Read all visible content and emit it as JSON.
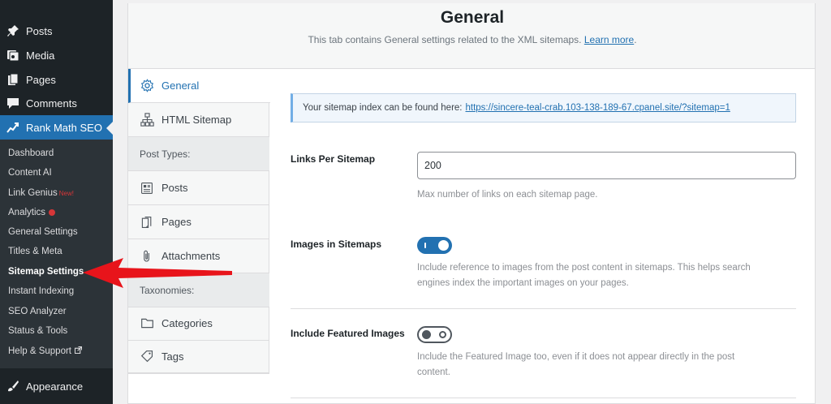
{
  "sidebar": {
    "menu": [
      {
        "label": "Posts",
        "icon": "pushpin-icon"
      },
      {
        "label": "Media",
        "icon": "media-icon"
      },
      {
        "label": "Pages",
        "icon": "pages-icon"
      },
      {
        "label": "Comments",
        "icon": "comment-icon"
      },
      {
        "label": "Rank Math SEO",
        "icon": "rank-math-icon"
      }
    ],
    "submenu": [
      {
        "label": "Dashboard"
      },
      {
        "label": "Content AI"
      },
      {
        "label": "Link Genius",
        "badge": "New!"
      },
      {
        "label": "Analytics"
      },
      {
        "label": "General Settings"
      },
      {
        "label": "Titles & Meta"
      },
      {
        "label": "Sitemap Settings"
      },
      {
        "label": "Instant Indexing"
      },
      {
        "label": "SEO Analyzer"
      },
      {
        "label": "Status & Tools"
      },
      {
        "label": "Help & Support"
      }
    ],
    "appearance": {
      "label": "Appearance",
      "icon": "brush-icon"
    }
  },
  "header": {
    "title": "General",
    "description": "This tab contains General settings related to the XML sitemaps.",
    "learn_more": "Learn more",
    "period": "."
  },
  "tabs": {
    "general": "General",
    "html_sitemap": "HTML Sitemap",
    "post_types_heading": "Post Types:",
    "posts": "Posts",
    "pages": "Pages",
    "attachments": "Attachments",
    "taxonomies_heading": "Taxonomies:",
    "categories": "Categories",
    "tags": "Tags"
  },
  "content": {
    "notice_text": "Your sitemap index can be found here:",
    "notice_link": "https://sincere-teal-crab.103-138-189-67.cpanel.site/?sitemap=1",
    "links_per_sitemap": {
      "label": "Links Per Sitemap",
      "value": "200",
      "description": "Max number of links on each sitemap page."
    },
    "images_in_sitemaps": {
      "label": "Images in Sitemaps",
      "enabled": true,
      "description_line1": "Include reference to images from the post content in sitemaps. This helps search",
      "description_line2": "engines index the important images on your pages."
    },
    "include_featured_images": {
      "label": "Include Featured Images",
      "enabled": false,
      "description_line1": "Include the Featured Image too, even if it does not appear directly in the post",
      "description_line2": "content."
    }
  },
  "colors": {
    "accent": "#2271b1",
    "sidebar_bg": "#1d2327",
    "annotation_arrow": "#e8141b"
  }
}
